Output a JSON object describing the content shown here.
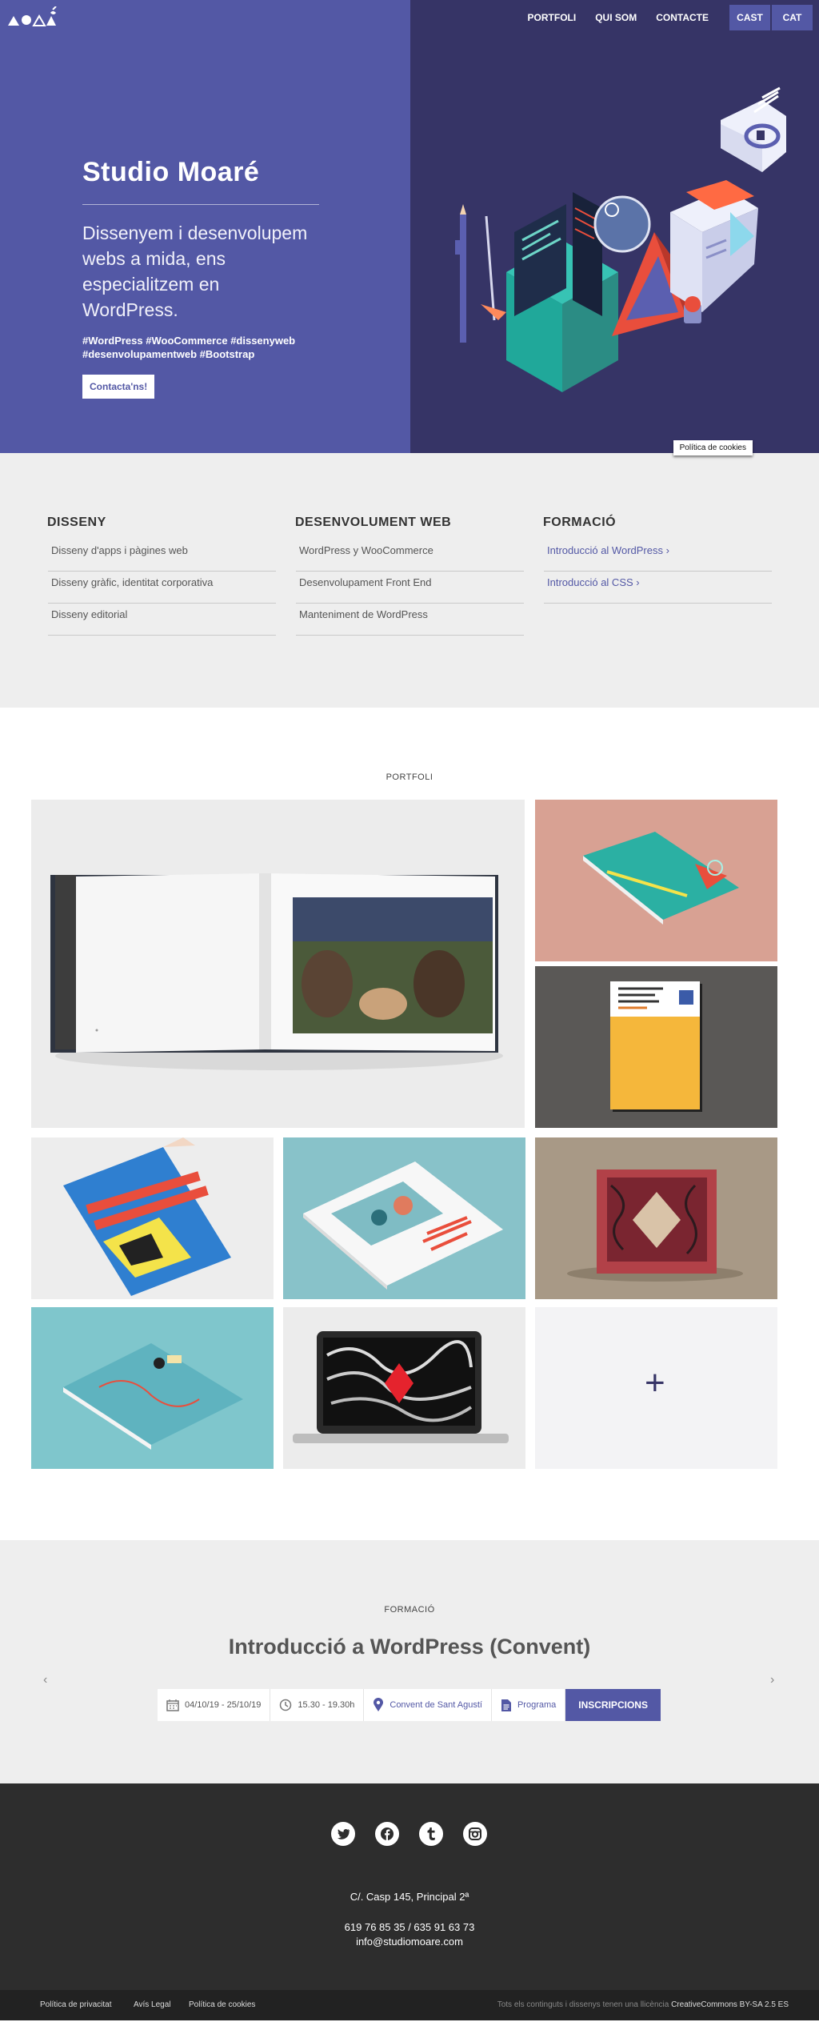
{
  "nav": {
    "links": [
      "PORTFOLI",
      "QUI SOM",
      "CONTACTE"
    ],
    "languages": [
      "CAST",
      "CAT"
    ]
  },
  "hero": {
    "title": "Studio Moaré",
    "subtitle": "Dissenyem i desenvolupem webs a mida, ens especialitzem en WordPress.",
    "tags_line1": "#WordPress #WooCommerce #dissenyweb",
    "tags_line2": "#desenvolupamentweb #Bootstrap",
    "cta": "Contacta'ns!",
    "cookie_label": "Política de cookies"
  },
  "services": [
    {
      "title": "DISSENY",
      "items": [
        "Disseny d'apps i pàgines web",
        "Disseny gràfic, identitat corporativa",
        "Disseny editorial"
      ]
    },
    {
      "title": "DESENVOLUMENT WEB",
      "items": [
        "WordPress y WooCommerce",
        "Desenvolupament Front End",
        "Manteniment de WordPress"
      ]
    },
    {
      "title": "FORMACIÓ",
      "items": [
        "Introducció al WordPress ›",
        "Introducció al CSS ›"
      ]
    }
  ],
  "portfolio": {
    "label": "PORTFOLI",
    "more_symbol": "+"
  },
  "formacio": {
    "label": "FORMACIÓ",
    "course_title": "Introducció a WordPress (Convent)",
    "dates": "04/10/19 - 25/10/19",
    "hours": "15.30 - 19.30h",
    "place": "Convent de Sant Agustí",
    "program": "Programa",
    "button": "INSCRIPCIONS",
    "prev": "‹",
    "next": "›"
  },
  "footer": {
    "socials": [
      "twitter-icon",
      "facebook-icon",
      "tumblr-icon",
      "instagram-icon"
    ],
    "address": "C/. Casp 145, Principal 2ª",
    "phones": "619 76 85 35 / 635 91 63 73",
    "email": "info@studiomoare.com",
    "legal_links": [
      "Política de privacitat",
      "Avís Legal",
      "Política de cookies"
    ],
    "license_text": "Tots els continguts i dissenys tenen una llicència",
    "license_name": "CreativeCommons BY-SA 2.5 ES"
  },
  "colors": {
    "brand": "#5358a5",
    "dark": "#363466",
    "light_bg": "#eeeeee",
    "footer": "#2d2d2d"
  }
}
